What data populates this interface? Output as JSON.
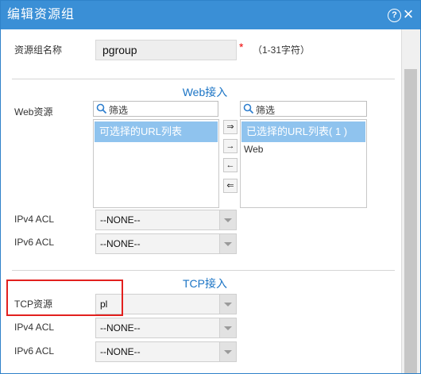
{
  "dialog": {
    "title": "编辑资源组"
  },
  "icons": {
    "help": "question-circle-icon",
    "close": "close-x-icon",
    "search": "magnifier-icon"
  },
  "form": {
    "name_label": "资源组名称",
    "name_value": "pgroup",
    "required_mark": "*",
    "name_hint": "（1-31字符）"
  },
  "web": {
    "section_title": "Web接入",
    "resource_label": "Web资源",
    "filter_left_placeholder": "筛选",
    "filter_right_placeholder": "筛选",
    "available_header": "可选择的URL列表",
    "selected_header": "已选择的URL列表( 1 )",
    "selected_items": [
      "Web"
    ],
    "arrow_buttons": [
      "⇒",
      "→",
      "←",
      "⇐"
    ],
    "ipv4_label": "IPv4 ACL",
    "ipv4_value": "--NONE--",
    "ipv6_label": "IPv6 ACL",
    "ipv6_value": "--NONE--"
  },
  "tcp": {
    "section_title": "TCP接入",
    "resource_label": "TCP资源",
    "resource_value": "pl",
    "ipv4_label": "IPv4 ACL",
    "ipv4_value": "--NONE--",
    "ipv6_label": "IPv6 ACL",
    "ipv6_value": "--NONE--"
  },
  "colors": {
    "titlebar": "#3a8fd6",
    "accent": "#1b74c5",
    "list_header": "#8fc3ee",
    "highlight": "#e2201e"
  }
}
